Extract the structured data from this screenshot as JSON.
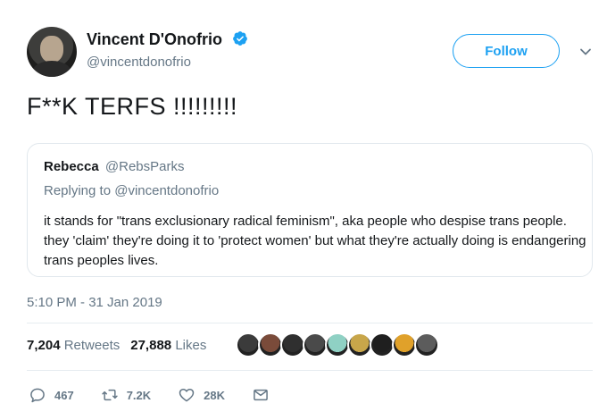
{
  "author": {
    "name": "Vincent D'Onofrio",
    "handle": "@vincentdonofrio",
    "verified": true
  },
  "follow_label": "Follow",
  "tweet_text": "F**K TERFS !!!!!!!!!",
  "quoted": {
    "name": "Rebecca",
    "handle": "@RebsParks",
    "replying_prefix": "Replying to",
    "replying_to": "@vincentdonofrio",
    "body": "it stands for \"trans exclusionary radical feminism\", aka people who despise trans people. they 'claim' they're doing it to 'protect women' but what they're actually doing is endangering trans peoples lives."
  },
  "timestamp": "5:10 PM - 31 Jan 2019",
  "stats": {
    "retweets_count": "7,204",
    "retweets_label": "Retweets",
    "likes_count": "27,888",
    "likes_label": "Likes"
  },
  "likers": [
    {
      "icon": "liker-avatar",
      "color": "#3b3b3b"
    },
    {
      "icon": "liker-avatar",
      "color": "#7a4b3a"
    },
    {
      "icon": "liker-avatar",
      "color": "#2f2f2f"
    },
    {
      "icon": "liker-avatar",
      "color": "#4a4a4a"
    },
    {
      "icon": "liker-avatar",
      "color": "#8fd1c4"
    },
    {
      "icon": "liker-avatar",
      "color": "#c8a64a"
    },
    {
      "icon": "liker-avatar",
      "color": "#1f1f1f"
    },
    {
      "icon": "liker-avatar",
      "color": "#e0a12a"
    },
    {
      "icon": "liker-avatar",
      "color": "#5c5c5c"
    }
  ],
  "actions": {
    "replies": "467",
    "retweets": "7.2K",
    "likes": "28K"
  },
  "colors": {
    "accent": "#1da1f2",
    "muted": "#657786",
    "text": "#14171a",
    "border": "#e1e8ed"
  }
}
